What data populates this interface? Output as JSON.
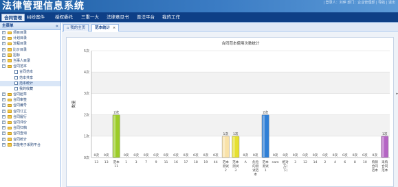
{
  "app": {
    "title": "法律管理信息系统",
    "header_links": "| 登录人：刘晔  部门：企业管理部  |  导航  |  退出"
  },
  "menu": {
    "items": [
      "合同管理",
      "纠纷案件",
      "授权委托",
      "三重一大",
      "法律意见书",
      "普法平台",
      "我的工作"
    ]
  },
  "left_panel": {
    "title": "主菜单",
    "collapse_glyph": "«",
    "tree": [
      {
        "label": "项目目录",
        "kind": "folder"
      },
      {
        "label": "计划目录",
        "kind": "folder"
      },
      {
        "label": "流程目录",
        "kind": "folder"
      },
      {
        "label": "比价目录",
        "kind": "folder"
      },
      {
        "label": "招标",
        "kind": "folder"
      },
      {
        "label": "当事人目录",
        "kind": "folder"
      },
      {
        "label": "合同范本",
        "kind": "folder",
        "expanded": true
      },
      {
        "label": "合同范本",
        "kind": "doc"
      },
      {
        "label": "范本共享",
        "kind": "doc"
      },
      {
        "label": "范本统计",
        "kind": "doc",
        "selected": true
      },
      {
        "label": "我的收藏",
        "kind": "doc"
      },
      {
        "label": "合同起草",
        "kind": "folder"
      },
      {
        "label": "合同审签",
        "kind": "folder"
      },
      {
        "label": "合同编号",
        "kind": "folder"
      },
      {
        "label": "合同订立",
        "kind": "folder"
      },
      {
        "label": "合同履行",
        "kind": "folder"
      },
      {
        "label": "合同评价",
        "kind": "folder"
      },
      {
        "label": "合同归档",
        "kind": "folder"
      },
      {
        "label": "合同查询",
        "kind": "folder"
      },
      {
        "label": "合同统计",
        "kind": "folder"
      },
      {
        "label": "华能电子采购平台",
        "kind": "folder"
      }
    ]
  },
  "tabs": [
    {
      "label": "我的主页",
      "icon": "home-icon",
      "active": false
    },
    {
      "label": "范本统计",
      "active": true,
      "close_glyph": "×"
    }
  ],
  "chart_data": {
    "type": "bar",
    "title": "合同范本使用次数统计",
    "ylabel": "数量",
    "ylim": [
      0,
      5
    ],
    "yticks": [
      "0次",
      "1次",
      "2次",
      "3次",
      "4次",
      "5次"
    ],
    "grid": true,
    "categories": [
      "13",
      "13",
      "范本11",
      "1",
      "3",
      "7",
      "9",
      "11",
      "16",
      "17",
      "18",
      "19",
      "44",
      "范本测试2",
      "范本测试3",
      "A",
      "危险的测试范本",
      "范本测试1",
      "nam",
      "相对方(下)",
      "3",
      "12",
      "14",
      "2",
      "4",
      "6",
      "8",
      "10",
      "购销合同范本",
      "采购合同范本"
    ],
    "values": [
      0,
      0,
      2,
      0,
      0,
      0,
      0,
      0,
      0,
      0,
      0,
      0,
      0,
      1,
      1,
      0,
      0,
      2,
      0,
      0,
      0,
      0,
      0,
      0,
      0,
      0,
      0,
      0,
      0,
      1
    ],
    "value_labels": [
      "0次",
      "0次",
      "2次",
      "0次",
      "0次",
      "0次",
      "0次",
      "0次",
      "0次",
      "0次",
      "0次",
      "0次",
      "0次",
      "1次",
      "1次",
      "0次",
      "0次",
      "2次",
      "0次",
      "0次",
      "0次",
      "0次",
      "0次",
      "0次",
      "0次",
      "0次",
      "0次",
      "0次",
      "0次",
      "1次"
    ],
    "bar_colors": {
      "2": "#9ccc28",
      "13": "#f9e2a8",
      "14": "#e6e030",
      "17": "#2f7fd6",
      "29": "#b565c4"
    }
  }
}
